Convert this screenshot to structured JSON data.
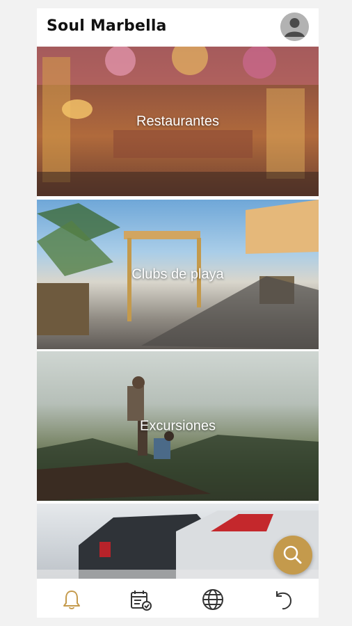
{
  "app": {
    "title": "Soul Marbella",
    "accent_color": "#c49a4c"
  },
  "header": {
    "avatar_icon": "user-avatar-icon"
  },
  "cards": [
    {
      "label": "Restaurantes",
      "icon": "restaurant-photo"
    },
    {
      "label": "Clubs de playa",
      "icon": "beach-club-photo"
    },
    {
      "label": "Excursiones",
      "icon": "hiking-photo"
    },
    {
      "label": "",
      "icon": "cars-photo"
    }
  ],
  "fab": {
    "icon": "search-icon"
  },
  "bottom_nav": {
    "items": [
      {
        "icon": "bell-icon",
        "active": true
      },
      {
        "icon": "calendar-check-icon",
        "active": false
      },
      {
        "icon": "globe-icon",
        "active": false
      },
      {
        "icon": "undo-icon",
        "active": false
      }
    ]
  }
}
